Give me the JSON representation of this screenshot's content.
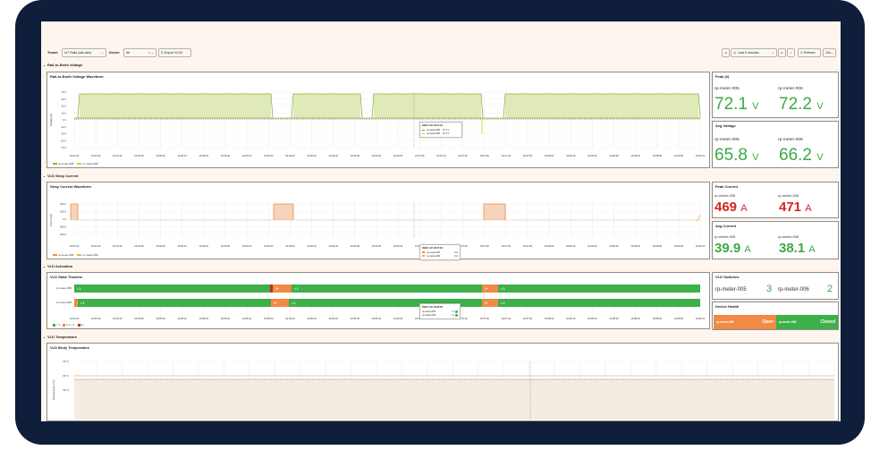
{
  "toolbar": {
    "tenant_label": "Tenant",
    "tenant_value": "IoT Rails (rail-rails)",
    "device_label": "Device",
    "device_value": "All",
    "export_label": "Export XLSX",
    "time_range": "Last 5 minutes",
    "refresh_label": "Refresh",
    "interval": "10s"
  },
  "sections": {
    "ret": "Rail-to-Earth Voltage",
    "stray": "VLD Stray Current",
    "activation": "VLD Activation",
    "temperature": "VLD Temperature"
  },
  "time_ticks": [
    "19:04:20",
    "19:04:30",
    "19:04:40",
    "19:04:50",
    "19:05:00",
    "19:05:10",
    "19:05:20",
    "19:05:30",
    "19:05:42",
    "19:05:50",
    "19:06:00",
    "19:06:10",
    "19:06:20",
    "19:06:30",
    "19:06:40",
    "19:06:50",
    "19:07:00",
    "19:07:10",
    "19:07:20",
    "19:07:30",
    "19:07:40",
    "19:07:50",
    "19:08:00",
    "19:08:10",
    "19:08:20",
    "19:08:30",
    "19:08:40",
    "19:08:50",
    "19:09:00",
    "19:09:10"
  ],
  "series_names": [
    "rp-meter-005",
    "rp-meter-006"
  ],
  "colors": {
    "green": "#8ab43c",
    "green_fill": "#dfeab8",
    "yellow": "#e2c21e",
    "orange": "#ef8c4c",
    "orange_fill": "#f6d3bb",
    "red_text": "#d1261f",
    "green_text": "#3fa845",
    "state_green": "#3eb049",
    "state_orange": "#f08a44",
    "state_red": "#c0302a"
  },
  "voltage_panel": {
    "title": "Rail-to-Earth Voltage Waveform",
    "ylabel": "Voltage (V)",
    "yticks": [
      "70 V",
      "50 V",
      "30 V",
      "10 V",
      "0 V",
      "-10 V",
      "-30 V",
      "-50 V",
      "-70 V"
    ],
    "tooltip": {
      "time": "2026-7-22 19:07:04",
      "rows": [
        {
          "name": "rp-meter-005",
          "value": "72.1 V"
        },
        {
          "name": "rp-meter-006",
          "value": "72.1 V"
        }
      ]
    }
  },
  "stray_panel": {
    "title": "Stray Current Waveform",
    "ylabel": "Current (A)",
    "yticks": [
      "400 A",
      "200 A",
      "0 A",
      "-200 A",
      "-400 A"
    ],
    "tooltip": {
      "time": "2026-7-22 19:07:04",
      "rows": [
        {
          "name": "rp-meter-005",
          "value": "0 A"
        },
        {
          "name": "rp-meter-006",
          "value": "0 A"
        }
      ]
    }
  },
  "state_panel": {
    "title": "VLD State Timeline",
    "rows": [
      "rp-meter-005",
      "rp-meter-006"
    ],
    "legend": [
      "< 1",
      "≥ 1 + 1",
      "2+"
    ],
    "tooltip": {
      "time": "2026-7-22 19:06:00",
      "rows": [
        {
          "name": "rp-meter-005",
          "value": "< 1"
        },
        {
          "name": "rp-meter-006",
          "value": "< 1"
        }
      ]
    }
  },
  "temp_panel": {
    "title": "VLD Body Temperature",
    "ylabel": "Temperature (°C)",
    "yticks": [
      "40 °C",
      "30 °C",
      "30 °C"
    ]
  },
  "peak_voltage": {
    "title": "Peak |V|",
    "items": [
      {
        "name": "rp-meter-005",
        "value": "72.1",
        "unit": "V"
      },
      {
        "name": "rp-meter-006",
        "value": "72.2",
        "unit": "V"
      }
    ]
  },
  "avg_voltage": {
    "title": "Avg Voltage",
    "items": [
      {
        "name": "rp-meter-005",
        "value": "65.8",
        "unit": "V"
      },
      {
        "name": "rp-meter-006",
        "value": "66.2",
        "unit": "V"
      }
    ]
  },
  "peak_current": {
    "title": "Peak Current",
    "items": [
      {
        "name": "rp-meter-005",
        "value": "469",
        "unit": "A"
      },
      {
        "name": "rp-meter-006",
        "value": "471",
        "unit": "A"
      }
    ]
  },
  "avg_current": {
    "title": "Avg Current",
    "items": [
      {
        "name": "rp-meter-005",
        "value": "39.9",
        "unit": "A"
      },
      {
        "name": "rp-meter-006",
        "value": "38.1",
        "unit": "A"
      }
    ]
  },
  "vld_switches": {
    "title": "VLD Switches",
    "items": [
      {
        "name": "rp-meter-005",
        "value": "3"
      },
      {
        "name": "rp-meter-006",
        "value": "2"
      }
    ]
  },
  "device_health": {
    "title": "Device Health",
    "items": [
      {
        "name": "rp-meter-005",
        "status": "Open"
      },
      {
        "name": "rp-meter-006",
        "status": "Closed"
      }
    ]
  }
}
